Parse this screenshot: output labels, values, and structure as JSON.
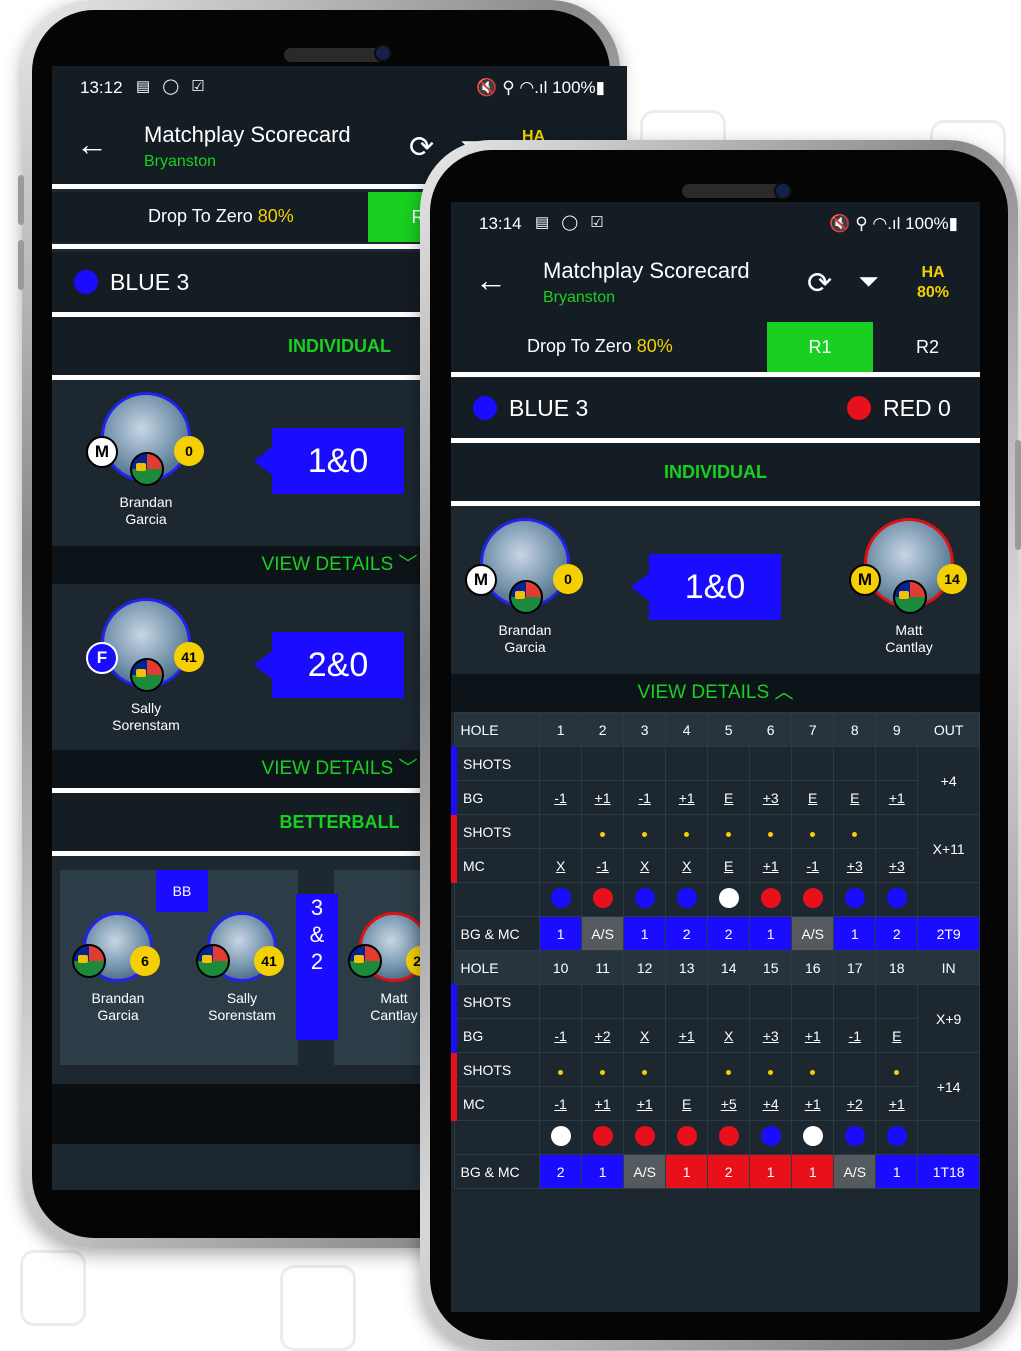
{
  "colors": {
    "accent_green": "#19d020",
    "blue_team": "#1a0cff",
    "red_team": "#e8101a",
    "ha_yellow": "#f5d000",
    "bg_dark": "#1d2730"
  },
  "phone1": {
    "status": {
      "time": "13:12",
      "icons": "▤ ◯ ☑",
      "right": "🔇 ⚲ ◠.ıl 100%▮"
    },
    "app": {
      "title": "Matchplay Scorecard",
      "subtitle": "Bryanston",
      "ha": "HA"
    },
    "tabs": {
      "drop_text": "Drop To Zero ",
      "drop_pct": "80%",
      "r1": "R1"
    },
    "team": {
      "name": "BLUE 3"
    },
    "sections": {
      "individual": "INDIVIDUAL",
      "betterball": "BETTERBALL"
    },
    "matches": [
      {
        "player": "Brandan\nGarcia",
        "gender": "M",
        "hcp": "0",
        "score": "1&0"
      },
      {
        "player": "Sally\nSorenstam",
        "gender": "F",
        "hcp": "41",
        "score": "2&0"
      }
    ],
    "view_details": "VIEW DETAILS ﹀",
    "betterball": {
      "tag": "BB",
      "p1": {
        "name": "Brandan\nGarcia",
        "hcp": "6"
      },
      "p2": {
        "name": "Sally\nSorenstam",
        "hcp": "41"
      },
      "score": "3\n&\n2",
      "p3": {
        "name": "Matt\nCantlay",
        "hcp": "20"
      }
    }
  },
  "phone2": {
    "status": {
      "time": "13:14",
      "icons": "▤ ◯ ☑",
      "right": "🔇 ⚲ ◠.ıl 100%▮"
    },
    "app": {
      "title": "Matchplay Scorecard",
      "subtitle": "Bryanston",
      "ha": "HA",
      "ha_pct": "80%"
    },
    "tabs": {
      "drop_text": "Drop To Zero ",
      "drop_pct": "80%",
      "r1": "R1",
      "r2": "R2"
    },
    "teams": {
      "blue": "BLUE 3",
      "red": "RED 0"
    },
    "section": "INDIVIDUAL",
    "match": {
      "left": {
        "name": "Brandan\nGarcia",
        "gender": "M",
        "hcp": "0"
      },
      "score": "1&0",
      "right": {
        "name": "Matt\nCantlay",
        "gender": "M",
        "hcp": "14"
      }
    },
    "view_details": "VIEW DETAILS ︿",
    "front": {
      "holes": [
        "HOLE",
        "1",
        "2",
        "3",
        "4",
        "5",
        "6",
        "7",
        "8",
        "9",
        "OUT"
      ],
      "shots_label": "SHOTS",
      "bg_label": "BG",
      "bg": [
        "-1",
        "+1",
        "-1",
        "+1",
        "E",
        "+3",
        "E",
        "E",
        "+1"
      ],
      "bg_total": "+4",
      "mc_shots": [
        0,
        1,
        1,
        1,
        1,
        1,
        1,
        1,
        0
      ],
      "mc_label": "MC",
      "mc": [
        "X",
        "-1",
        "X",
        "X",
        "E",
        "+1",
        "-1",
        "+3",
        "+3"
      ],
      "mc_total": "X+11",
      "dots": [
        "blue",
        "red",
        "blue",
        "blue",
        "white",
        "red",
        "red",
        "blue",
        "blue"
      ],
      "res_label": "BG & MC",
      "res": [
        "1",
        "A/S",
        "1",
        "2",
        "2",
        "1",
        "A/S",
        "1",
        "2"
      ],
      "res_colors": [
        "b",
        "g",
        "b",
        "b",
        "b",
        "b",
        "g",
        "b",
        "b"
      ],
      "res_total": "2T9"
    },
    "back": {
      "holes": [
        "HOLE",
        "10",
        "11",
        "12",
        "13",
        "14",
        "15",
        "16",
        "17",
        "18",
        "IN"
      ],
      "shots_label": "SHOTS",
      "bg_label": "BG",
      "bg": [
        "-1",
        "+2",
        "X",
        "+1",
        "X",
        "+3",
        "+1",
        "-1",
        "E"
      ],
      "bg_total": "X+9",
      "mc_shots": [
        1,
        1,
        1,
        0,
        1,
        1,
        1,
        0,
        1
      ],
      "mc_label": "MC",
      "mc": [
        "-1",
        "+1",
        "+1",
        "E",
        "+5",
        "+4",
        "+1",
        "+2",
        "+1"
      ],
      "mc_total": "+14",
      "dots": [
        "white",
        "red",
        "red",
        "red",
        "red",
        "blue",
        "white",
        "blue",
        "blue"
      ],
      "res_label": "BG & MC",
      "res": [
        "2",
        "1",
        "A/S",
        "1",
        "2",
        "1",
        "1",
        "A/S",
        "1"
      ],
      "res_colors": [
        "b",
        "b",
        "g",
        "r",
        "r",
        "r",
        "r",
        "g",
        "b"
      ],
      "res_total": "1T18"
    }
  }
}
